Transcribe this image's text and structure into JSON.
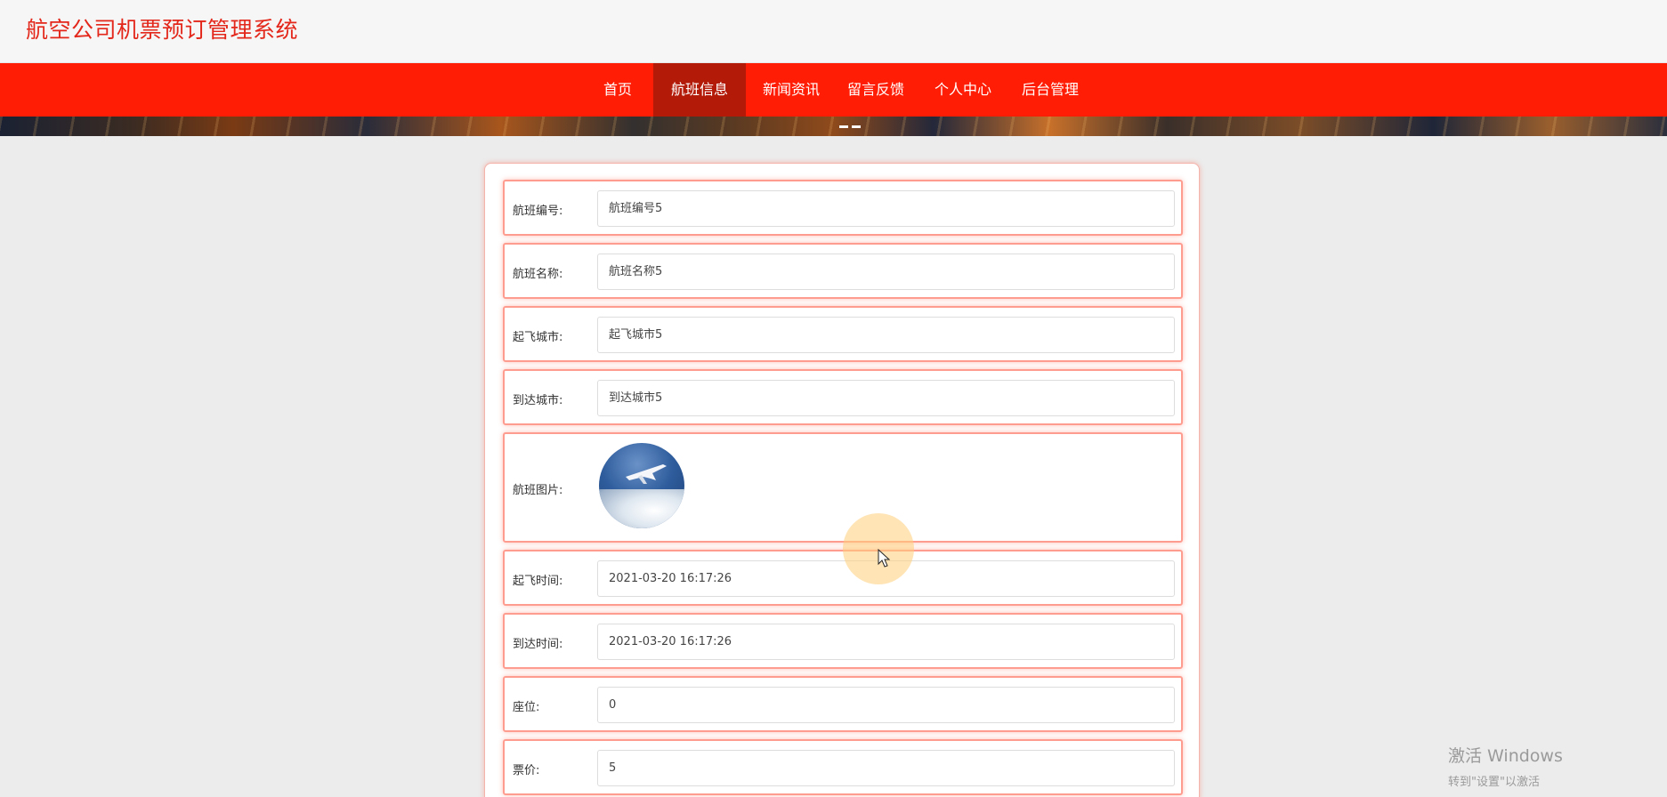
{
  "header": {
    "site_title": "航空公司机票预订管理系统"
  },
  "nav": {
    "items": [
      {
        "label": "首页"
      },
      {
        "label": "航班信息",
        "active": true
      },
      {
        "label": "新闻资讯"
      },
      {
        "label": "留言反馈"
      },
      {
        "label": "个人中心"
      },
      {
        "label": "后台管理"
      }
    ]
  },
  "form": {
    "flight_number": {
      "label": "航班编号:",
      "value": "航班编号5"
    },
    "flight_name": {
      "label": "航班名称:",
      "value": "航班名称5"
    },
    "departure_city": {
      "label": "起飞城市:",
      "value": "起飞城市5"
    },
    "arrival_city": {
      "label": "到达城市:",
      "value": "到达城市5"
    },
    "flight_image": {
      "label": "航班图片:"
    },
    "departure_time": {
      "label": "起飞时间:",
      "value": "2021-03-20 16:17:26"
    },
    "arrival_time": {
      "label": "到达时间:",
      "value": "2021-03-20 16:17:26"
    },
    "seats": {
      "label": "座位:",
      "value": "0"
    },
    "price": {
      "label": "票价:",
      "value": "5"
    }
  },
  "watermark": {
    "line1": "激活 Windows",
    "line2": "转到\"设置\"以激活"
  },
  "colors": {
    "brand_red": "#ff1d05",
    "active_nav": "#b31b08",
    "title_red": "#e3271b"
  },
  "icons": {
    "cursor": "mouse-pointer-icon"
  }
}
